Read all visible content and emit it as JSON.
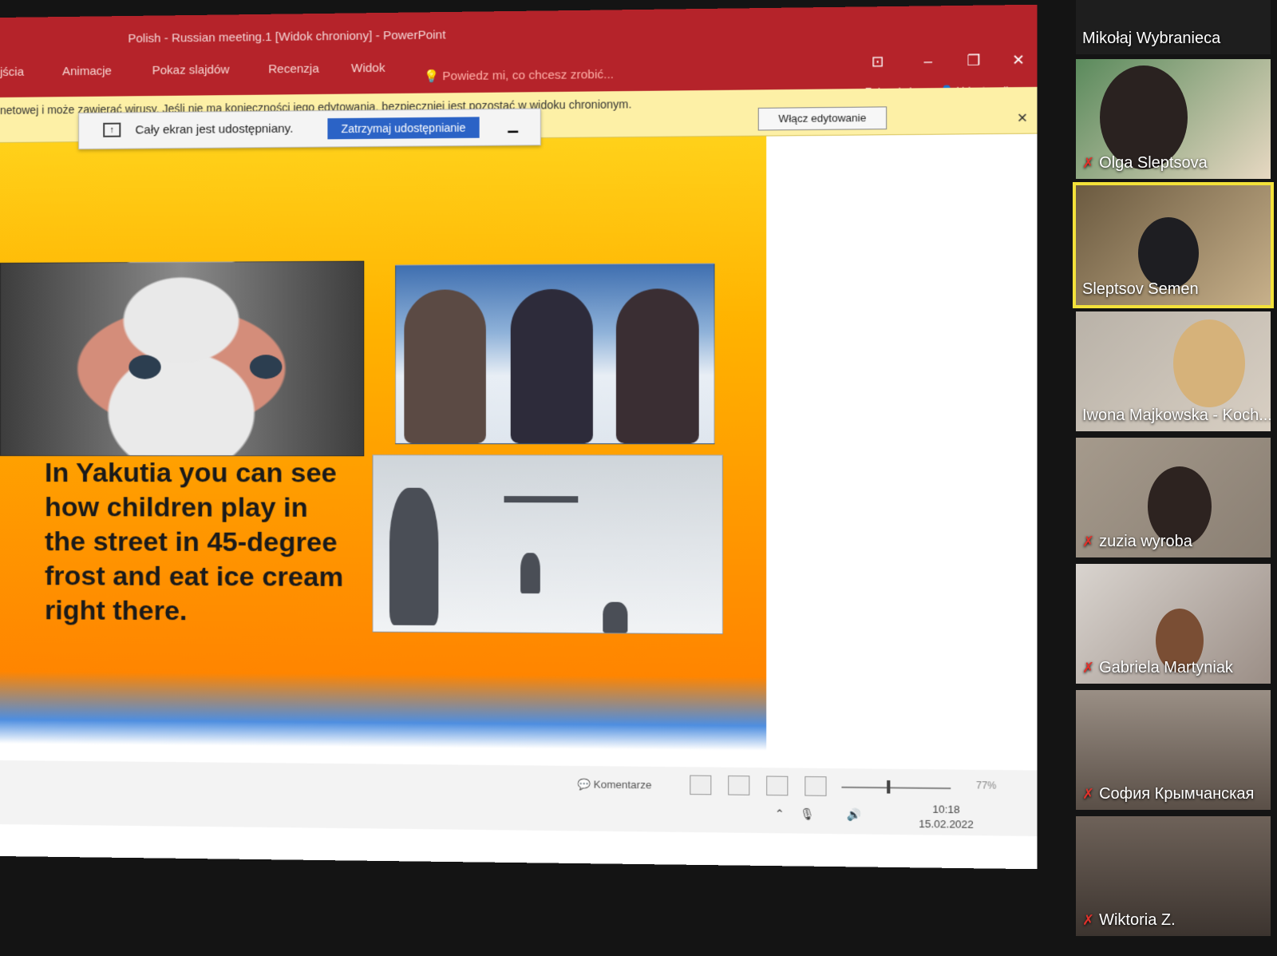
{
  "window": {
    "title": "Polish - Russian meeting.1 [Widok chroniony] - PowerPoint",
    "tabs": [
      "jścia",
      "Animacje",
      "Pokaz slajdów",
      "Recenzja",
      "Widok"
    ],
    "tell_me": "Powiedz mi, co chcesz zrobić...",
    "sign_in": "Zaloguj się",
    "share": "Udostępnij"
  },
  "protected_view": {
    "message": "netowej i może zawierać wirusy. Jeśli nie ma konieczności jego edytowania, bezpieczniej jest pozostać w widoku chronionym.",
    "enable_button": "Włącz edytowanie"
  },
  "screen_share": {
    "status": "Cały ekran jest udostępniany.",
    "stop_button": "Zatrzymaj udostępnianie"
  },
  "slide": {
    "text": "In Yakutia you can see how children play in the street in 45-degree frost and eat ice cream right there."
  },
  "status_bar": {
    "comments": "Komentarze",
    "zoom": "77%",
    "time": "10:18",
    "date": "15.02.2022"
  },
  "participants": [
    {
      "name": "Mikołaj Wybranieca",
      "muted": false,
      "active": false
    },
    {
      "name": "Olga Sleptsova",
      "muted": true,
      "active": false
    },
    {
      "name": "Sleptsov Semen",
      "muted": false,
      "active": true
    },
    {
      "name": "Iwona Majkowska - Koch...",
      "muted": false,
      "active": false
    },
    {
      "name": "zuzia wyroba",
      "muted": true,
      "active": false
    },
    {
      "name": "Gabriela Martyniak",
      "muted": true,
      "active": false
    },
    {
      "name": "София Крымчанская",
      "muted": true,
      "active": false
    },
    {
      "name": "Wiktoria Z.",
      "muted": true,
      "active": false
    }
  ]
}
